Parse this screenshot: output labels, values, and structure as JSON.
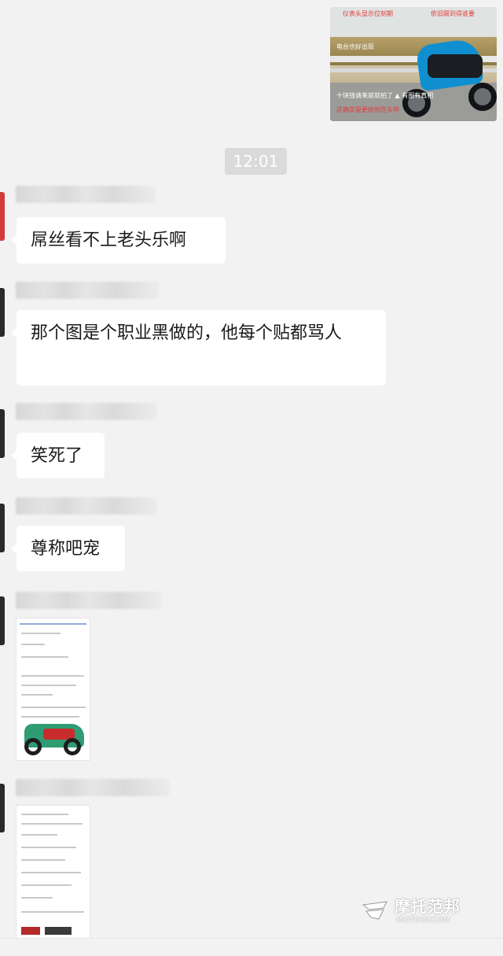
{
  "chat": {
    "timestamp": "12:01",
    "sent_image": {
      "alt_icon": "photo-icon",
      "captions": [
        "仪表头显示位刻期",
        "依旧踢到得谁要",
        "电台也好出现",
        "十块钱请来就就拍了 ▲ 有图有真相",
        "这确实是更给他在头带"
      ]
    },
    "messages": [
      {
        "type": "text",
        "text": "屌丝看不上老头乐啊"
      },
      {
        "type": "text",
        "text": "那个图是个职业黑做的，他每个贴都骂人"
      },
      {
        "type": "text",
        "text": "笑死了"
      },
      {
        "type": "text",
        "text": "尊称吧宠"
      },
      {
        "type": "image"
      },
      {
        "type": "image"
      }
    ],
    "colors": {
      "background": "#f2f2f2",
      "bubble": "#ffffff",
      "timestamp_bg": "#dadada",
      "avatar_red": "#d33b3b",
      "avatar_dark": "#2a2a2a"
    }
  },
  "watermark": {
    "icon": "moto-logo-icon",
    "name": "摩托范邦",
    "domain": "MOTOOY.COM"
  }
}
